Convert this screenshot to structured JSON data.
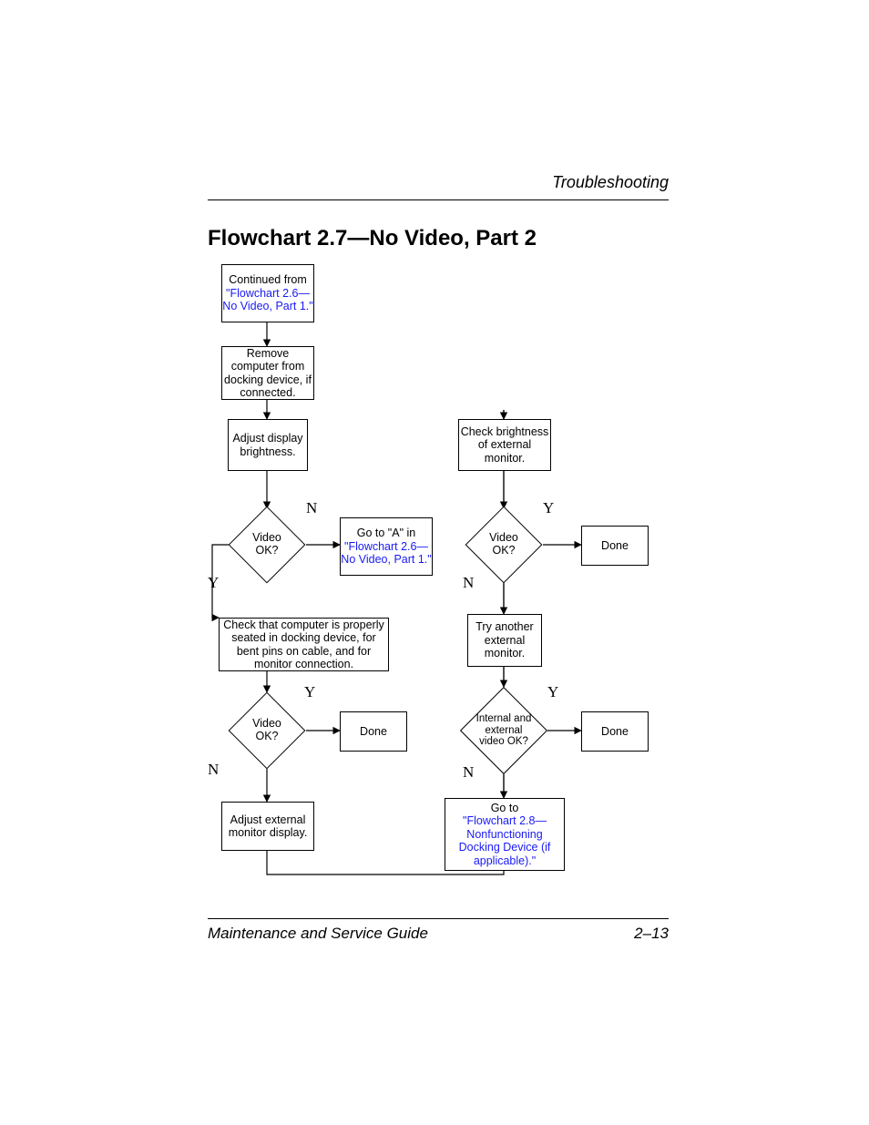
{
  "header": {
    "section": "Troubleshooting"
  },
  "title": "Flowchart 2.7—No Video, Part 2",
  "footer": {
    "left": "Maintenance and Service Guide",
    "right": "2–13"
  },
  "nodes": {
    "n1_intro": "Continued from ",
    "n1_link": "\"Flowchart 2.6—No Video, Part 1.\"",
    "n2": "Remove computer from docking device, if connected.",
    "n3": "Adjust display brightness.",
    "d1": "Video OK?",
    "n4_intro": "Go to \"A\" in ",
    "n4_link": "\"Flowchart 2.6—No Video, Part 1.\"",
    "n5": "Check that computer is properly seated in docking device, for bent pins on cable, and for monitor connection.",
    "d2": "Video OK?",
    "n6": "Done",
    "n7": "Adjust external monitor display.",
    "n8": "Check brightness of external monitor.",
    "d3": "Video OK?",
    "n9": "Done",
    "n10": "Try another external monitor.",
    "d4": "Internal and external video OK?",
    "n11": "Done",
    "n12_intro": "Go to ",
    "n12_link": "\"Flowchart 2.8—Nonfunctioning Docking Device (if applicable).\""
  },
  "labels": {
    "y": "Y",
    "n": "N"
  }
}
